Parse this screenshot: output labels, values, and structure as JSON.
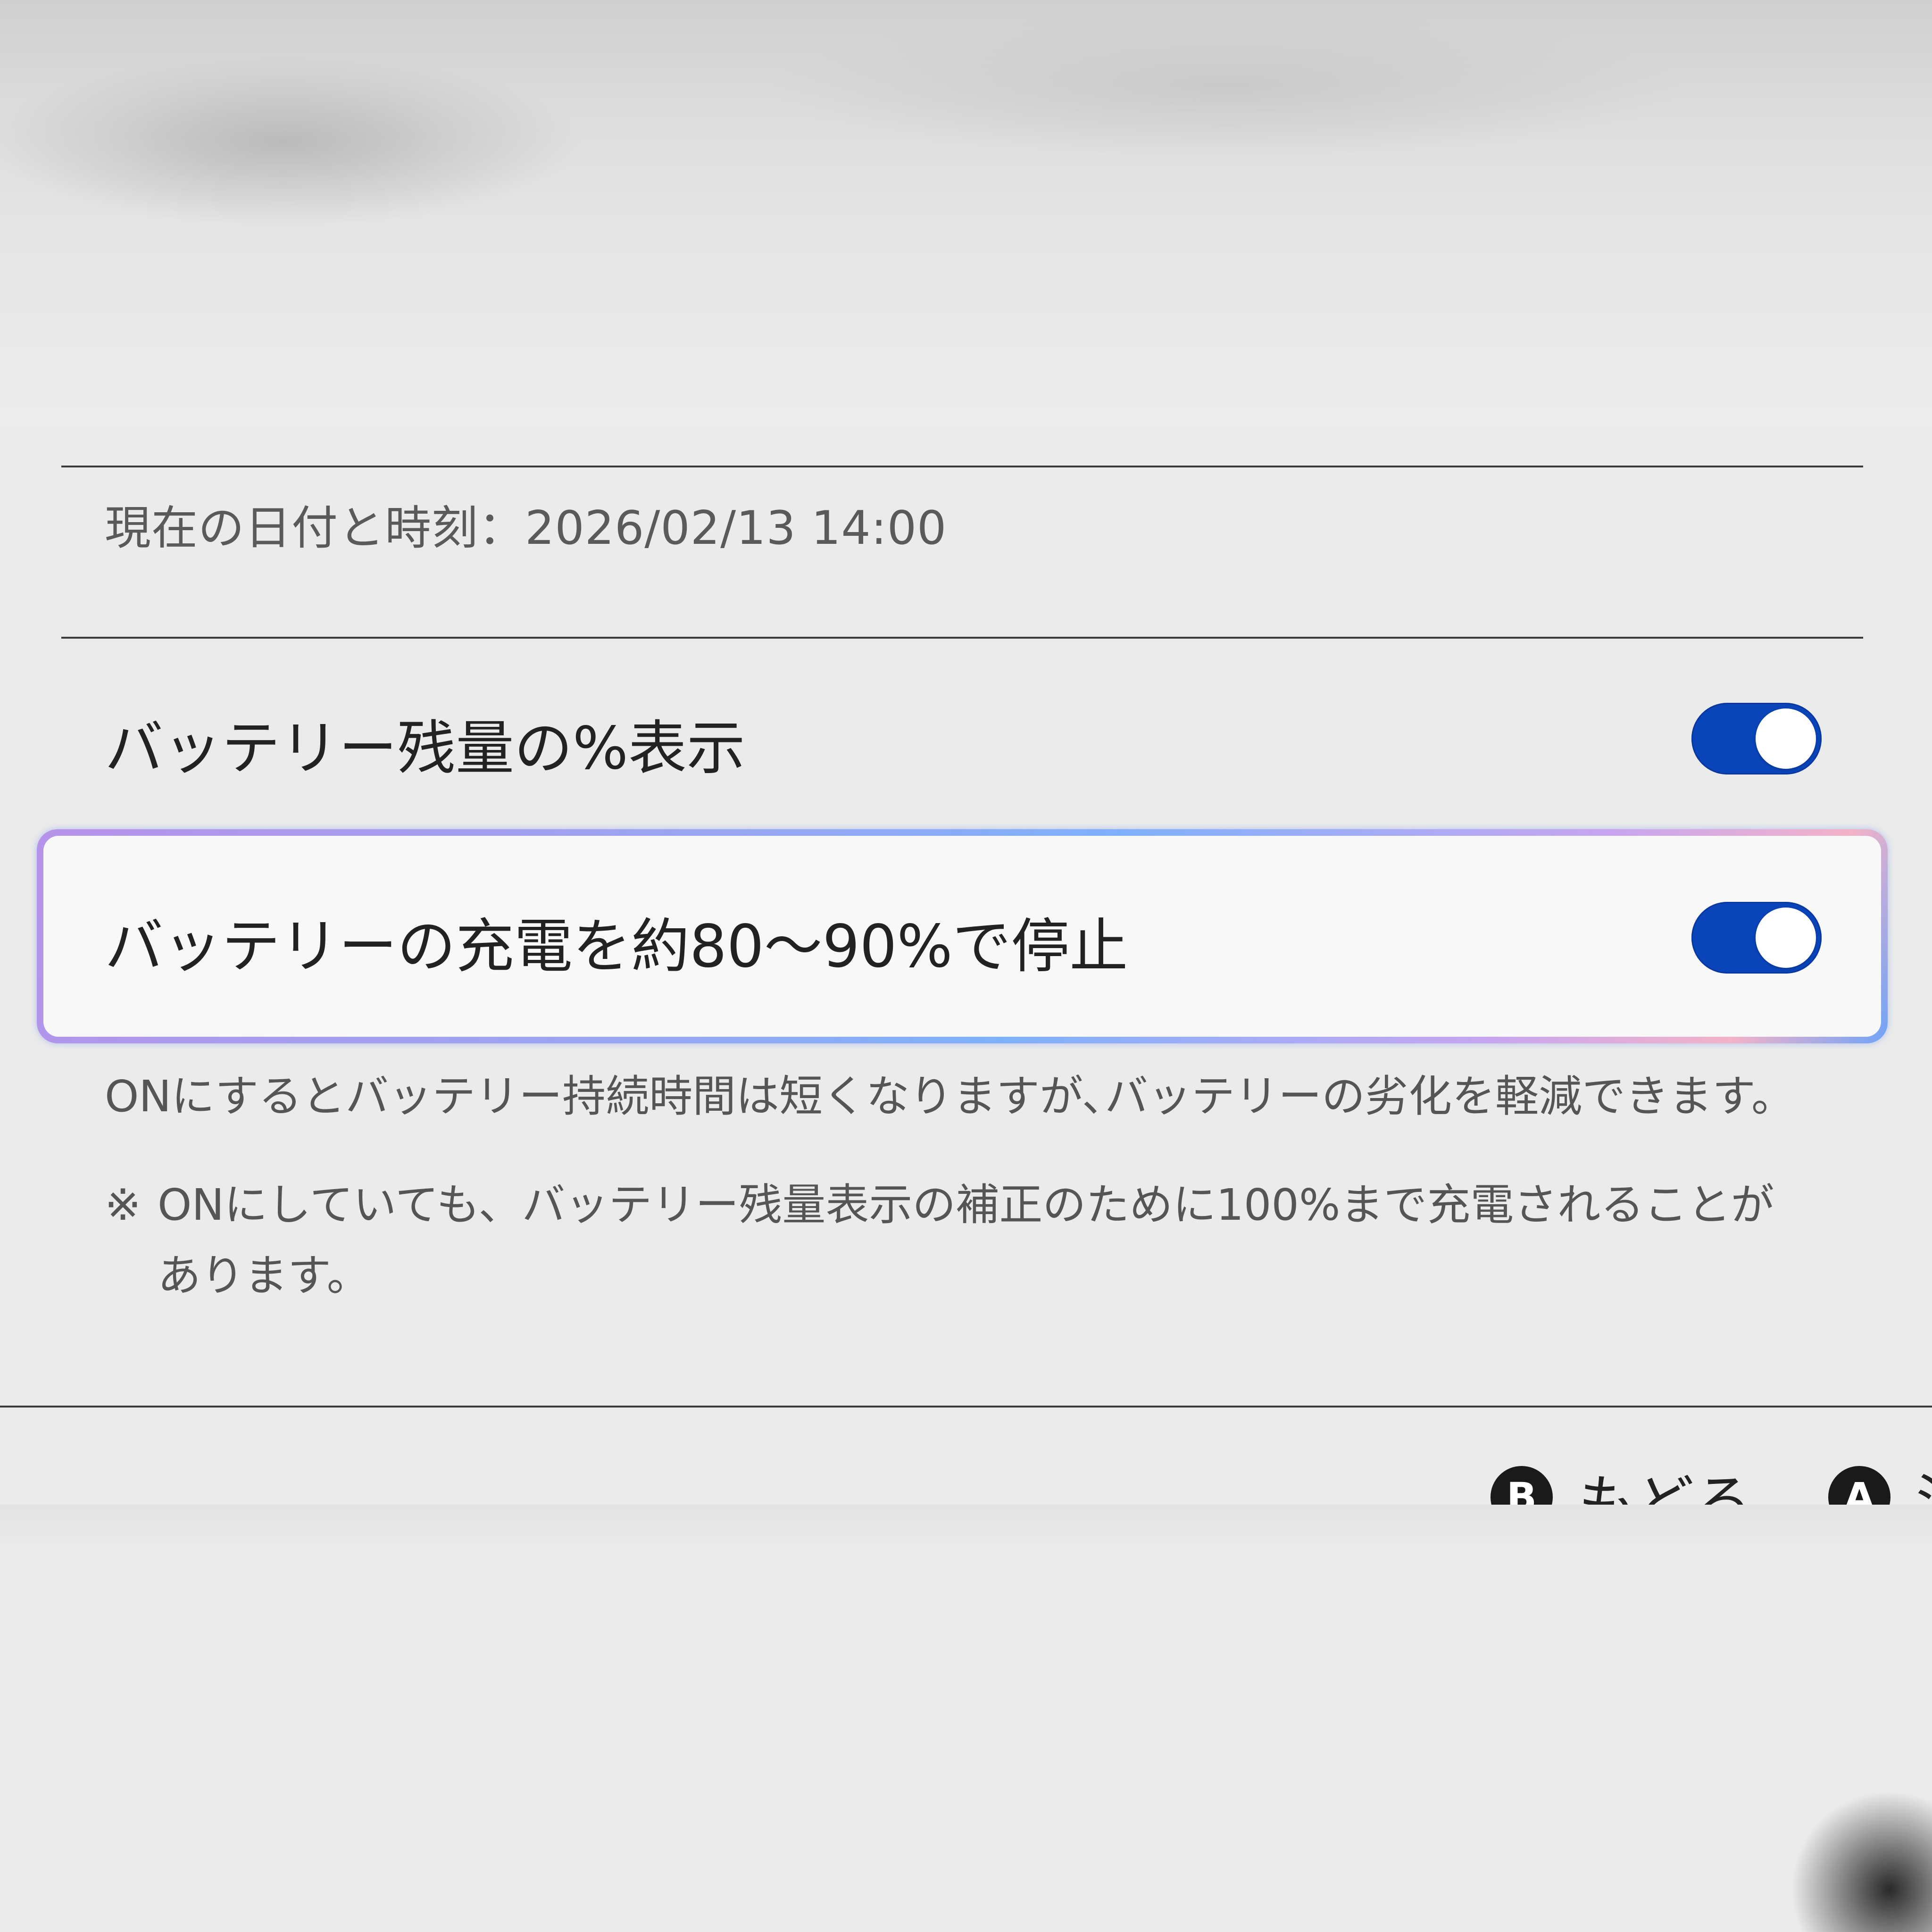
{
  "datetime": {
    "label": "現在の日付と時刻：2026/02/13 14:00"
  },
  "settings": [
    {
      "label": "バッテリー残量の%表示",
      "enabled": true
    },
    {
      "label": "バッテリーの充電を約80〜90%で停止",
      "enabled": true,
      "selected": true
    }
  ],
  "description": "ONにするとバッテリー持続時間は短くなりますが､バッテリーの劣化を軽減できます。",
  "note": {
    "mark": "※",
    "text": "ONにしていても、バッテリー残量表示の補正のために100%まで充電されることがあります。"
  },
  "footer": {
    "back": {
      "button": "B",
      "label": "もどる"
    },
    "confirm": {
      "button": "A",
      "label": "決定"
    }
  },
  "colors": {
    "toggle_on": "#0a44b9",
    "background": "#ebebeb",
    "selection_gradient_start": "#b793ea",
    "selection_gradient_end": "#6ea3f8"
  }
}
